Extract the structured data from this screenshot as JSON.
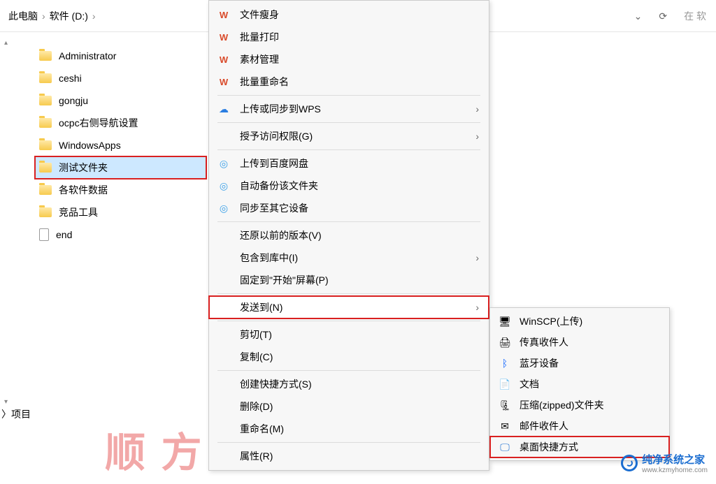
{
  "breadcrumb": {
    "root": "此电脑",
    "drive": "软件 (D:)"
  },
  "addr": {
    "down": "⌄",
    "refresh": "⟳",
    "search_prefix": "在 软"
  },
  "folders": [
    {
      "name": "Administrator",
      "type": "folder"
    },
    {
      "name": "ceshi",
      "type": "folder"
    },
    {
      "name": "gongju",
      "type": "folder"
    },
    {
      "name": "ocpc右侧导航设置",
      "type": "folder"
    },
    {
      "name": "WindowsApps",
      "type": "folder"
    },
    {
      "name": "测试文件夹",
      "type": "folder",
      "selected": true
    },
    {
      "name": "各软件数据",
      "type": "folder"
    },
    {
      "name": "竞品工具",
      "type": "folder"
    },
    {
      "name": "end",
      "type": "file"
    }
  ],
  "status": "〉项目",
  "menu": {
    "wps_slim": "文件瘦身",
    "wps_print": "批量打印",
    "wps_assets": "素材管理",
    "wps_rename": "批量重命名",
    "wps_upload": "上传或同步到WPS",
    "grant_access": "授予访问权限(G)",
    "baidu_upload": "上传到百度网盘",
    "baidu_backup": "自动备份该文件夹",
    "baidu_sync": "同步至其它设备",
    "restore": "还原以前的版本(V)",
    "include_lib": "包含到库中(I)",
    "pin_start": "固定到\"开始\"屏幕(P)",
    "send_to": "发送到(N)",
    "cut": "剪切(T)",
    "copy": "复制(C)",
    "shortcut": "创建快捷方式(S)",
    "delete": "删除(D)",
    "rename": "重命名(M)",
    "properties": "属性(R)"
  },
  "submenu": {
    "winscp": "WinSCP(上传)",
    "fax": "传真收件人",
    "bluetooth": "蓝牙设备",
    "docs": "文档",
    "zip": "压缩(zipped)文件夹",
    "mail": "邮件收件人",
    "desktop": "桌面快捷方式"
  },
  "watermark": {
    "title": "纯净系统之家",
    "url": "www.kzmyhome.com"
  },
  "deco": "顺 方"
}
